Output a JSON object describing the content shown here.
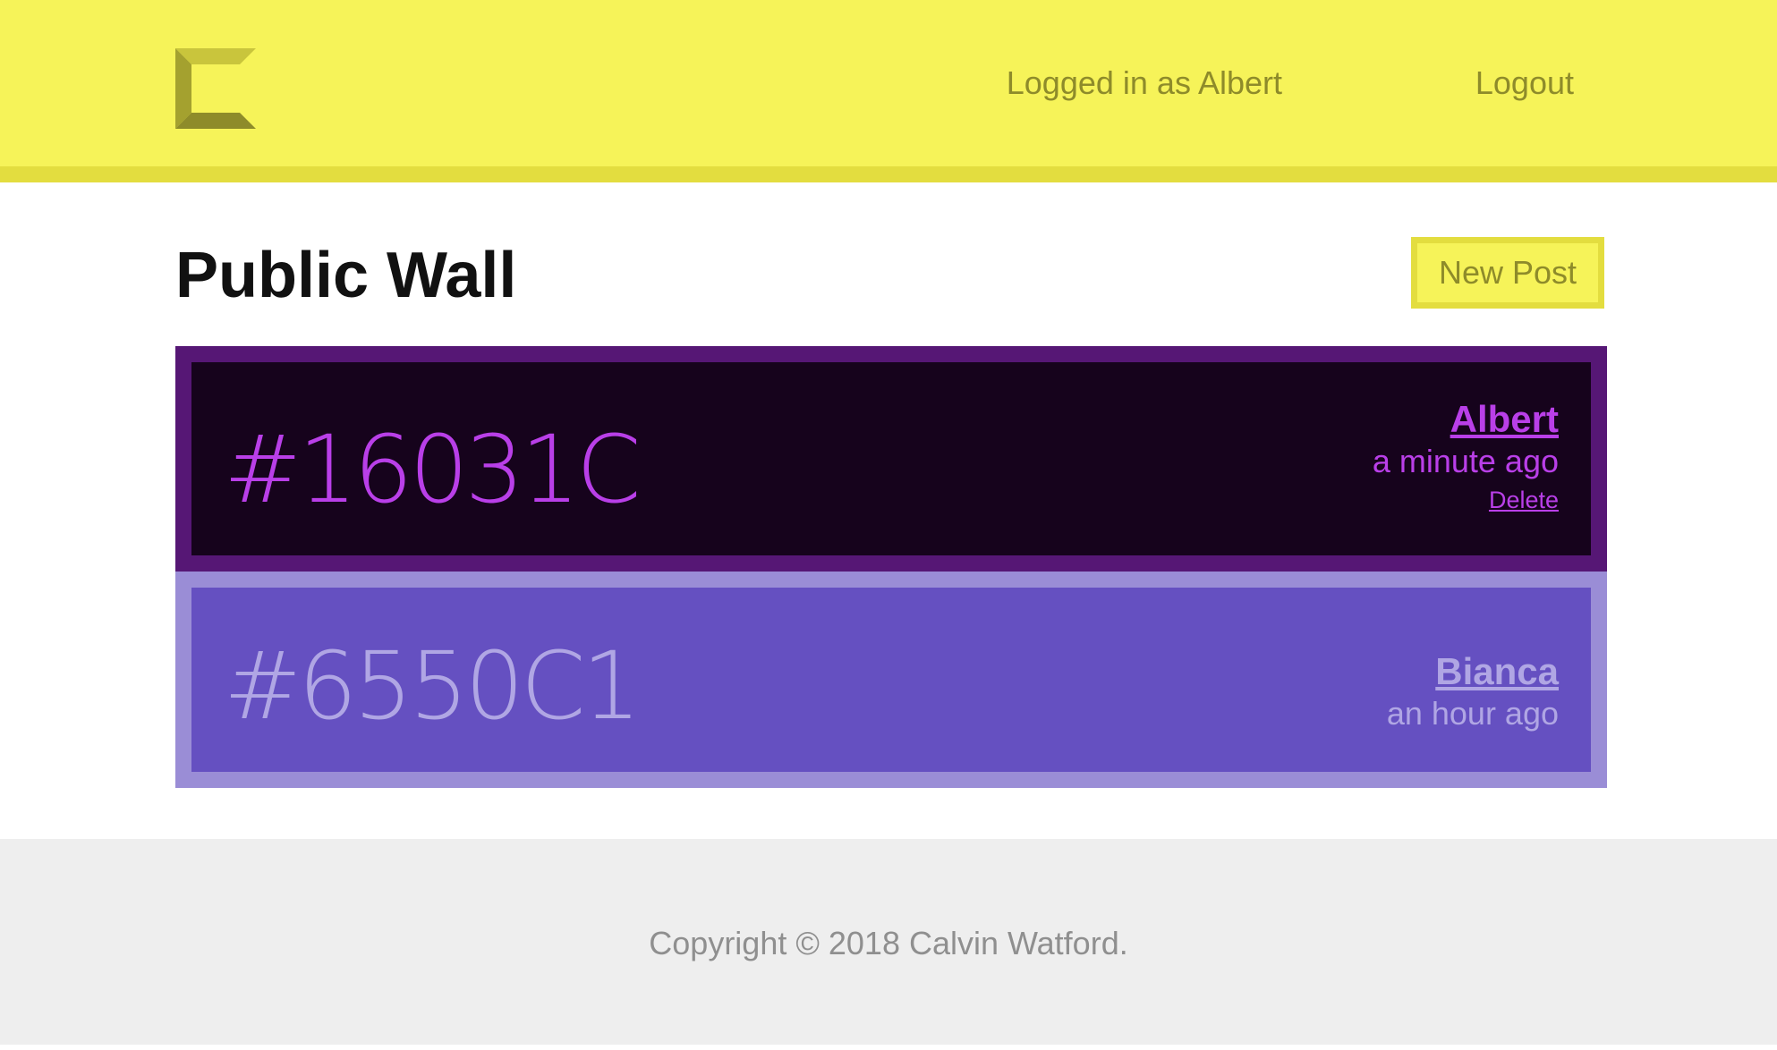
{
  "header": {
    "logo_icon": "calvin-c-logo-icon",
    "logged_in_text": "Logged in as Albert",
    "logout_label": "Logout"
  },
  "main": {
    "title": "Public Wall",
    "new_post_label": "New Post",
    "posts": [
      {
        "color": "#16031C",
        "author": "Albert",
        "time": "a minute ago",
        "delete_label": "Delete"
      },
      {
        "color": "#6550C1",
        "author": "Bianca",
        "time": "an hour ago"
      }
    ]
  },
  "footer": {
    "copyright": "Copyright © 2018 Calvin Watford."
  },
  "colors": {
    "header_bg": "#f6f359",
    "header_border": "#e3dd3f",
    "header_text": "#8e8b2a",
    "post1_bg": "#16031c",
    "post1_border": "#561775",
    "post1_text": "#b93fe8",
    "post2_bg": "#6550c1",
    "post2_border": "#9a8dd6",
    "post2_text": "#b0a6e4",
    "footer_bg": "#eeeeee",
    "footer_text": "#8f8f8f"
  }
}
